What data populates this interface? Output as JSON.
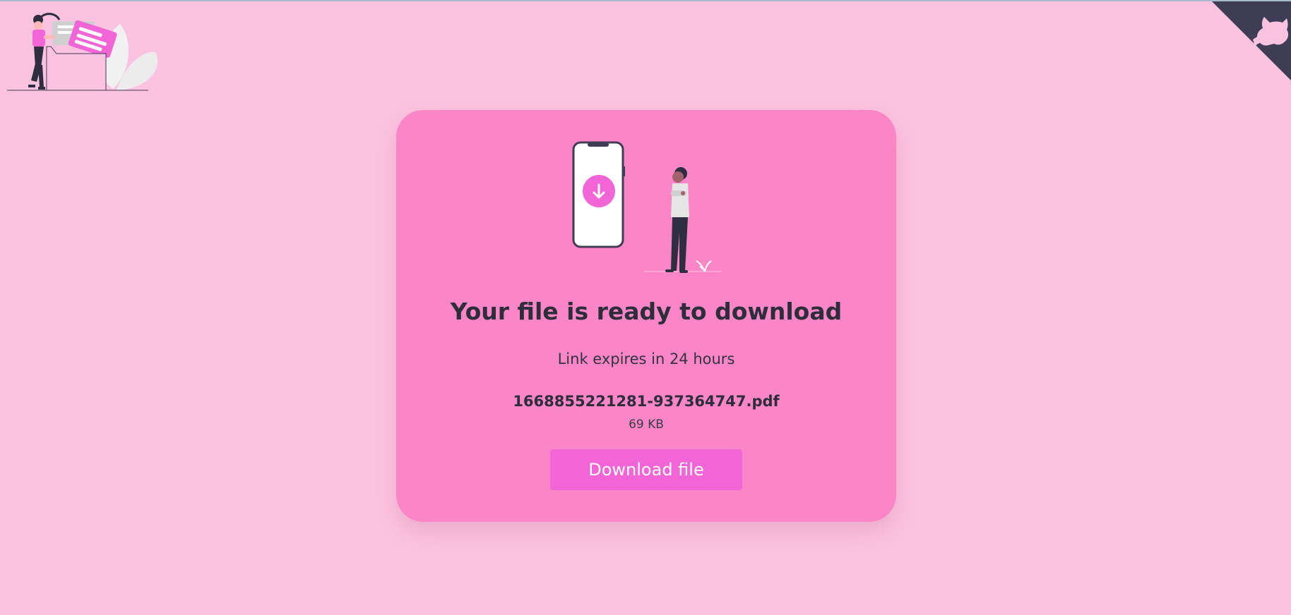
{
  "header": {
    "logo_icon": "files-folder-illustration-icon",
    "repo_link_icon": "github-octocat-icon"
  },
  "card": {
    "illustration_icon": "phone-download-person-illustration",
    "title": "Your file is ready to download",
    "expiry_text": "Link expires in 24 hours",
    "file_name": "1668855221281-937364747.pdf",
    "file_size": "69 KB",
    "download_label": "Download file"
  },
  "colors": {
    "page_background": "#fbc3df",
    "card_background": "#fa86c8",
    "button_background": "#f165d6",
    "text_dark": "#2d2d3b",
    "corner_background": "#3f3d56"
  }
}
